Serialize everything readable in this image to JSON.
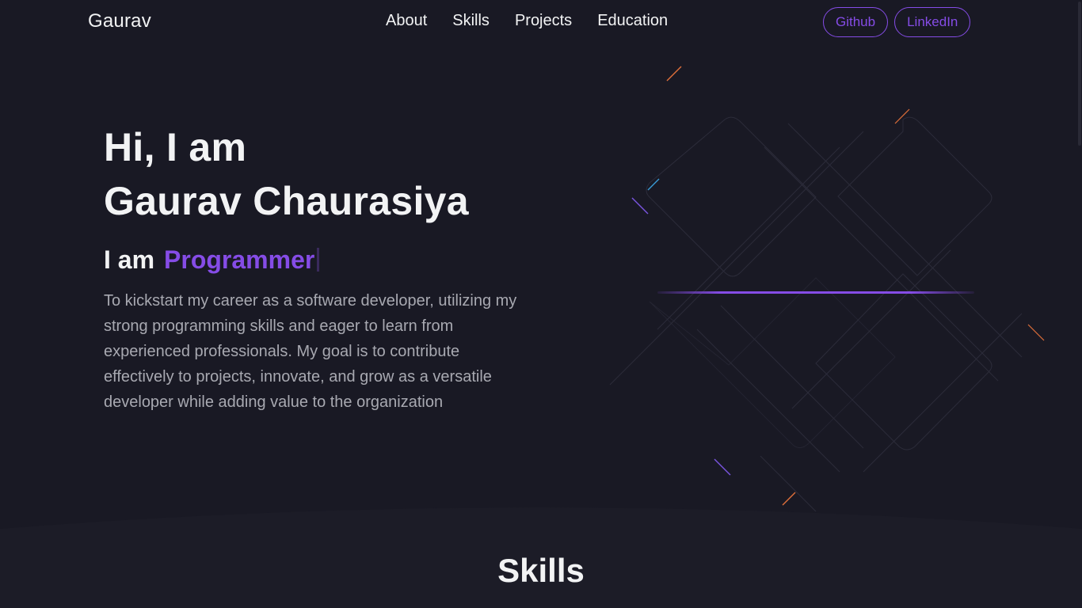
{
  "navbar": {
    "logo": "Gaurav",
    "links": [
      "About",
      "Skills",
      "Projects",
      "Education"
    ],
    "buttons": [
      "Github",
      "LinkedIn"
    ]
  },
  "hero": {
    "title_line1": "Hi, I am",
    "title_line2": "Gaurav Chaurasiya",
    "role_prefix": "I am",
    "role": "Programmer",
    "description": "To kickstart my career as a software developer, utilizing my strong programming skills and eager to learn from experienced professionals. My goal is to contribute effectively to projects, innovate, and grow as a versatile developer while adding value to the organization"
  },
  "skills": {
    "title": "Skills"
  },
  "colors": {
    "background": "#191924",
    "accent": "#854ce6",
    "text_primary": "#f2f3f4",
    "text_secondary": "#a8a9b1"
  }
}
